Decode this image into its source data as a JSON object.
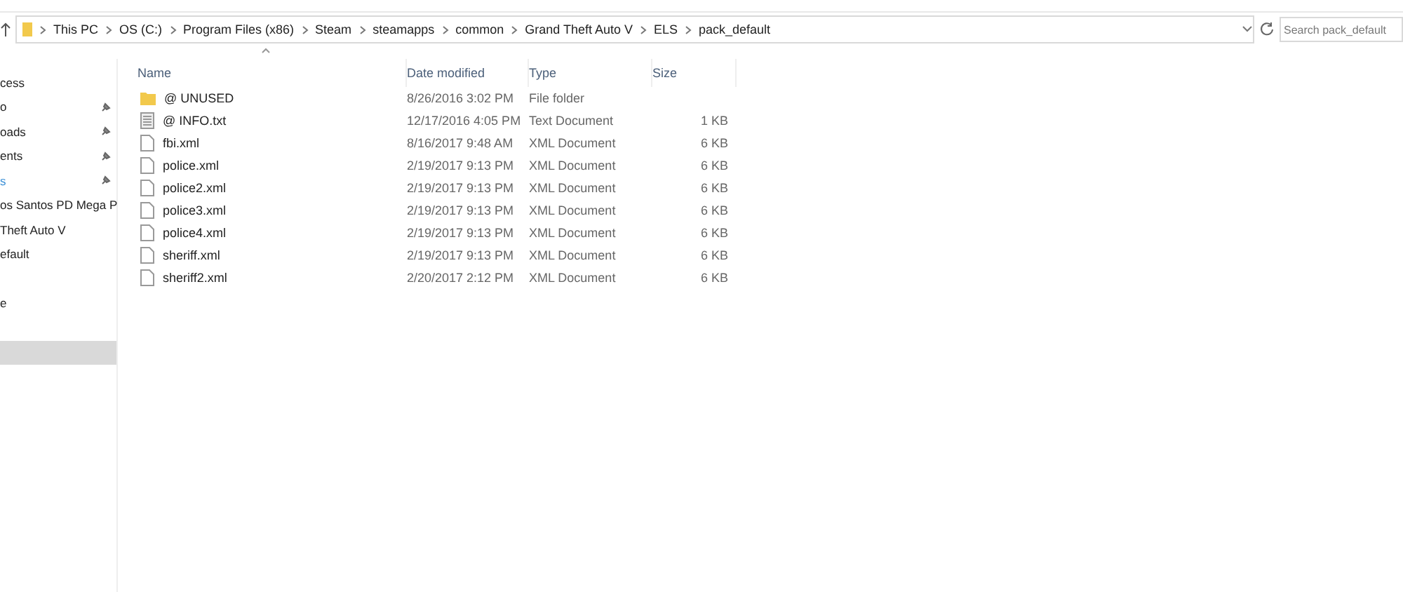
{
  "address_bar": {
    "crumbs": [
      "This PC",
      "OS (C:)",
      "Program Files (x86)",
      "Steam",
      "steamapps",
      "common",
      "Grand Theft Auto V",
      "ELS",
      "pack_default"
    ]
  },
  "search": {
    "placeholder": "Search pack_default"
  },
  "sidebar": {
    "items": [
      {
        "label": "cess",
        "pinned": false,
        "selected": false,
        "accent": false
      },
      {
        "label": "o",
        "pinned": true,
        "selected": false,
        "accent": false
      },
      {
        "label": "oads",
        "pinned": true,
        "selected": false,
        "accent": false
      },
      {
        "label": "ents",
        "pinned": true,
        "selected": false,
        "accent": false
      },
      {
        "label": "s",
        "pinned": true,
        "selected": false,
        "accent": true
      },
      {
        "label": "os Santos PD Mega P",
        "pinned": false,
        "selected": false,
        "accent": false
      },
      {
        "label": "Theft Auto V",
        "pinned": false,
        "selected": false,
        "accent": false
      },
      {
        "label": "efault",
        "pinned": false,
        "selected": false,
        "accent": false
      },
      {
        "label": "e",
        "pinned": false,
        "selected": false,
        "accent": false
      },
      {
        "selected": true
      }
    ]
  },
  "table": {
    "columns": [
      "Name",
      "Date modified",
      "Type",
      "Size"
    ],
    "rows": [
      {
        "kind": "folder",
        "name": "@ UNUSED",
        "date": "8/26/2016 3:02 PM",
        "type": "File folder"
      },
      {
        "kind": "text",
        "name": "@ INFO.txt",
        "date": "12/17/2016 4:05 PM",
        "type": "Text Document",
        "size": "1 KB"
      },
      {
        "kind": "file",
        "name": "fbi.xml",
        "date": "8/16/2017 9:48 AM",
        "type": "XML Document",
        "size": "6 KB"
      },
      {
        "kind": "file",
        "name": "police.xml",
        "date": "2/19/2017 9:13 PM",
        "type": "XML Document",
        "size": "6 KB"
      },
      {
        "kind": "file",
        "name": "police2.xml",
        "date": "2/19/2017 9:13 PM",
        "type": "XML Document",
        "size": "6 KB"
      },
      {
        "kind": "file",
        "name": "police3.xml",
        "date": "2/19/2017 9:13 PM",
        "type": "XML Document",
        "size": "6 KB"
      },
      {
        "kind": "file",
        "name": "police4.xml",
        "date": "2/19/2017 9:13 PM",
        "type": "XML Document",
        "size": "6 KB"
      },
      {
        "kind": "file",
        "name": "sheriff.xml",
        "date": "2/19/2017 9:13 PM",
        "type": "XML Document",
        "size": "6 KB"
      },
      {
        "kind": "file",
        "name": "sheriff2.xml",
        "date": "2/20/2017 2:12 PM",
        "type": "XML Document",
        "size": "6 KB"
      }
    ]
  }
}
